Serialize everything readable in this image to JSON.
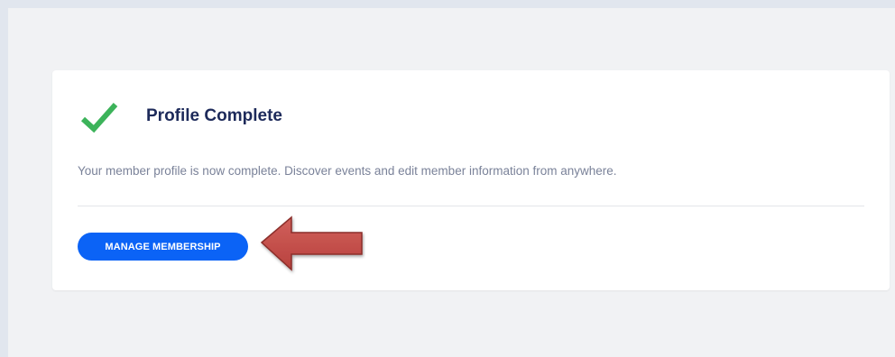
{
  "profile_card": {
    "title": "Profile Complete",
    "description": "Your member profile is now complete. Discover events and edit member information from anywhere.",
    "manage_button_label": "MANAGE MEMBERSHIP",
    "status_icon": "checkmark-icon"
  },
  "annotation": {
    "icon": "left-arrow-icon",
    "color": "#c0504d"
  },
  "colors": {
    "check": "#3cb35a",
    "title": "#1d2a5a",
    "button": "#0b63f6",
    "arrow": "#c0504d"
  }
}
